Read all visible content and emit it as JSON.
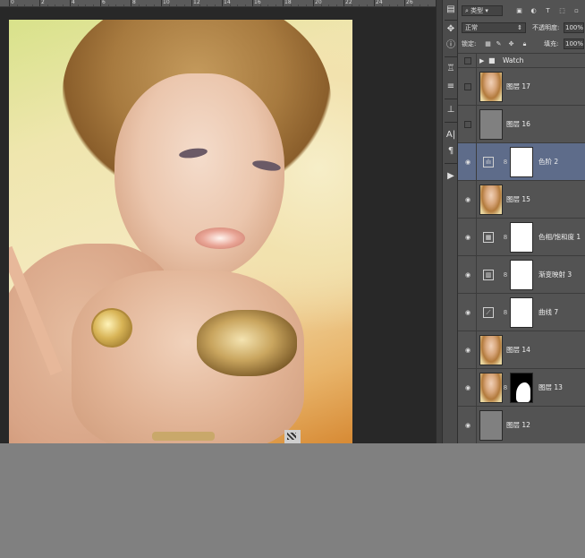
{
  "ruler": {
    "labels": [
      "0",
      "2",
      "4",
      "6",
      "8",
      "10",
      "12",
      "14",
      "16",
      "18",
      "20",
      "22",
      "24",
      "26"
    ]
  },
  "panel": {
    "filter_kind": "类型",
    "blend_mode": "正常",
    "opacity_label": "不透明度:",
    "opacity_value": "100%",
    "lock_label": "锁定:",
    "fill_label": "填充:",
    "fill_value": "100%"
  },
  "layers": [
    {
      "name": "Watch",
      "kind": "group",
      "visible": false
    },
    {
      "name": "图层 17",
      "kind": "photo",
      "visible": false
    },
    {
      "name": "图层 16",
      "kind": "gray",
      "visible": false
    },
    {
      "name": "色阶 2",
      "kind": "adjust-levels",
      "visible": true,
      "selected": true
    },
    {
      "name": "图层 15",
      "kind": "photo",
      "visible": true
    },
    {
      "name": "色相/饱和度 1",
      "kind": "adjust-hue",
      "visible": true
    },
    {
      "name": "渐变映射 3",
      "kind": "adjust-gradient",
      "visible": true
    },
    {
      "name": "曲线 7",
      "kind": "adjust-curves",
      "visible": true
    },
    {
      "name": "图层 14",
      "kind": "photo",
      "visible": true
    },
    {
      "name": "图层 13",
      "kind": "photo-mask",
      "visible": true
    },
    {
      "name": "图层 12",
      "kind": "gray",
      "visible": true
    }
  ],
  "icons": {
    "eye": "eye-icon",
    "chain": "link-icon",
    "folder": "folder-icon"
  }
}
